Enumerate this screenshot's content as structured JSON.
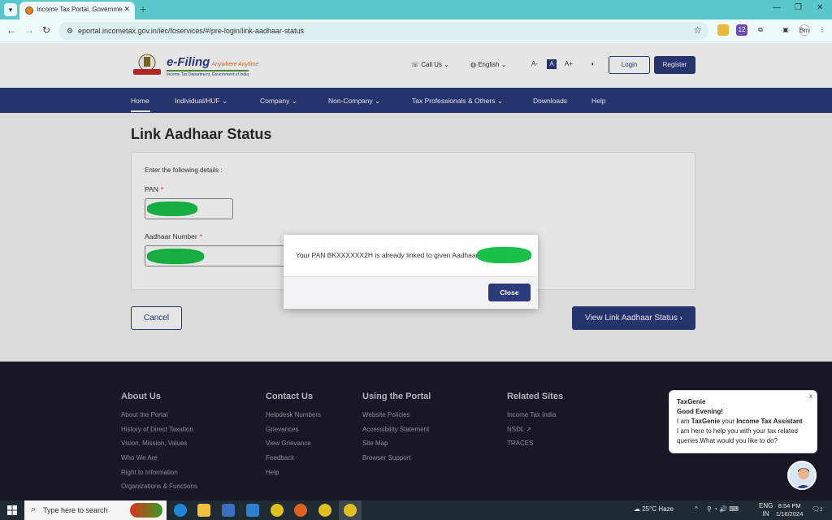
{
  "browser": {
    "tab_title": "Income Tax Portal, Government",
    "url": "eportal.incometax.gov.in/iec/foservices/#/pre-login/link-aadhaar-status",
    "profile_initials": "Bm",
    "ext_badge": "12"
  },
  "header": {
    "logo_title": "e-Filing",
    "logo_tagline": "Anywhere Anytime",
    "logo_subtitle": "Income Tax Department, Government of India",
    "call_us": "Call Us",
    "language": "English",
    "font_smaller": "A-",
    "font_normal": "A",
    "font_larger": "A+",
    "login": "Login",
    "register": "Register"
  },
  "nav": {
    "items": [
      "Home",
      "Individual/HUF",
      "Company",
      "Non-Company",
      "Tax Professionals & Others",
      "Downloads",
      "Help"
    ]
  },
  "main": {
    "title": "Link Aadhaar Status",
    "hint": "Enter the following details :",
    "pan_label": "PAN",
    "aadhaar_label": "Aadhaar Number",
    "required_mark": "*",
    "cancel": "Cancel",
    "view_status": "View Link Aadhaar Status ›"
  },
  "modal": {
    "message": "Your PAN BKXXXXXX2H is already linked to given Aadhaar",
    "close": "Close"
  },
  "footer": {
    "columns": [
      {
        "heading": "About Us",
        "links": [
          "About the Portal",
          "History of Direct Taxation",
          "Vision, Mission, Values",
          "Who We Are",
          "Right to Information",
          "Organizations & Functions"
        ]
      },
      {
        "heading": "Contact Us",
        "links": [
          "Helpdesk Numbers",
          "Grievances",
          "View Grievance",
          "Feedback",
          "Help"
        ]
      },
      {
        "heading": "Using the Portal",
        "links": [
          "Website Policies",
          "Accessibility Statement",
          "Site Map",
          "Browser Support"
        ]
      },
      {
        "heading": "Related Sites",
        "links": [
          "Income Tax India",
          "NSDL ↗",
          "TRACES"
        ]
      }
    ]
  },
  "chat": {
    "name": "TaxGenie",
    "greeting": "Good Evening!",
    "line1_prefix": "I am ",
    "line1_name": "TaxGenie",
    "line1_mid": " your ",
    "line1_role": "Income Tax Assistant",
    "line2": "I am here to help you with your tax related",
    "line3": "queries.What would you like to do?",
    "close": "x"
  },
  "taskbar": {
    "search_placeholder": "Type here to search",
    "weather": "25°C  Haze",
    "language": "ENG",
    "region": "IN",
    "time": "8:54 PM",
    "date": "1/16/2024",
    "notification_count": "2"
  },
  "colors": {
    "primary": "#2b3a7b",
    "browser_frame": "#5cc6cd",
    "redaction": "#19c14a",
    "footer_bg": "#1a1a2b"
  }
}
